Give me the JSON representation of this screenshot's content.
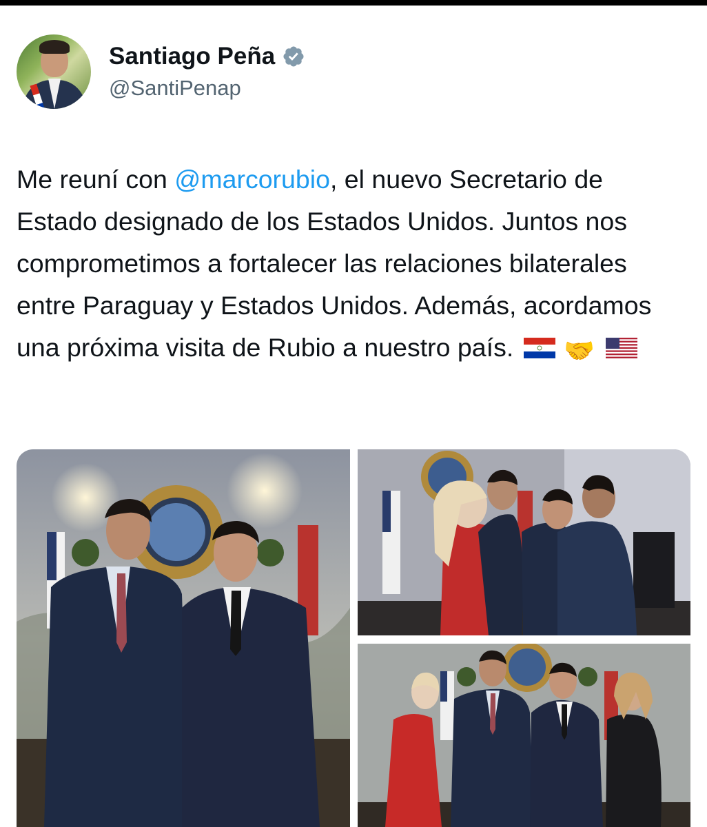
{
  "author": {
    "display_name": "Santiago Peña",
    "handle": "@SantiPenap",
    "verified_icon": "verified-badge-icon",
    "badge_color": "#829aab"
  },
  "tweet": {
    "text_before_mention": "Me reuní con ",
    "mention": "@marcorubio",
    "text_after_mention": ", el nuevo Secretario de Estado designado de los Estados Unidos. Juntos nos comprometimos a fortalecer las relaciones bilaterales entre Paraguay y Estados Unidos. Además, acordamos una próxima visita de Rubio a nuestro país.",
    "emoji_flag_paraguay": "🇵🇾",
    "emoji_handshake": "🤝",
    "emoji_flag_usa": "🇺🇸",
    "mention_color": "#1d9bf0"
  },
  "media": {
    "count": 3,
    "items": [
      "photo-two-men-standing",
      "photo-group-conversation",
      "photo-four-people-posing"
    ]
  }
}
